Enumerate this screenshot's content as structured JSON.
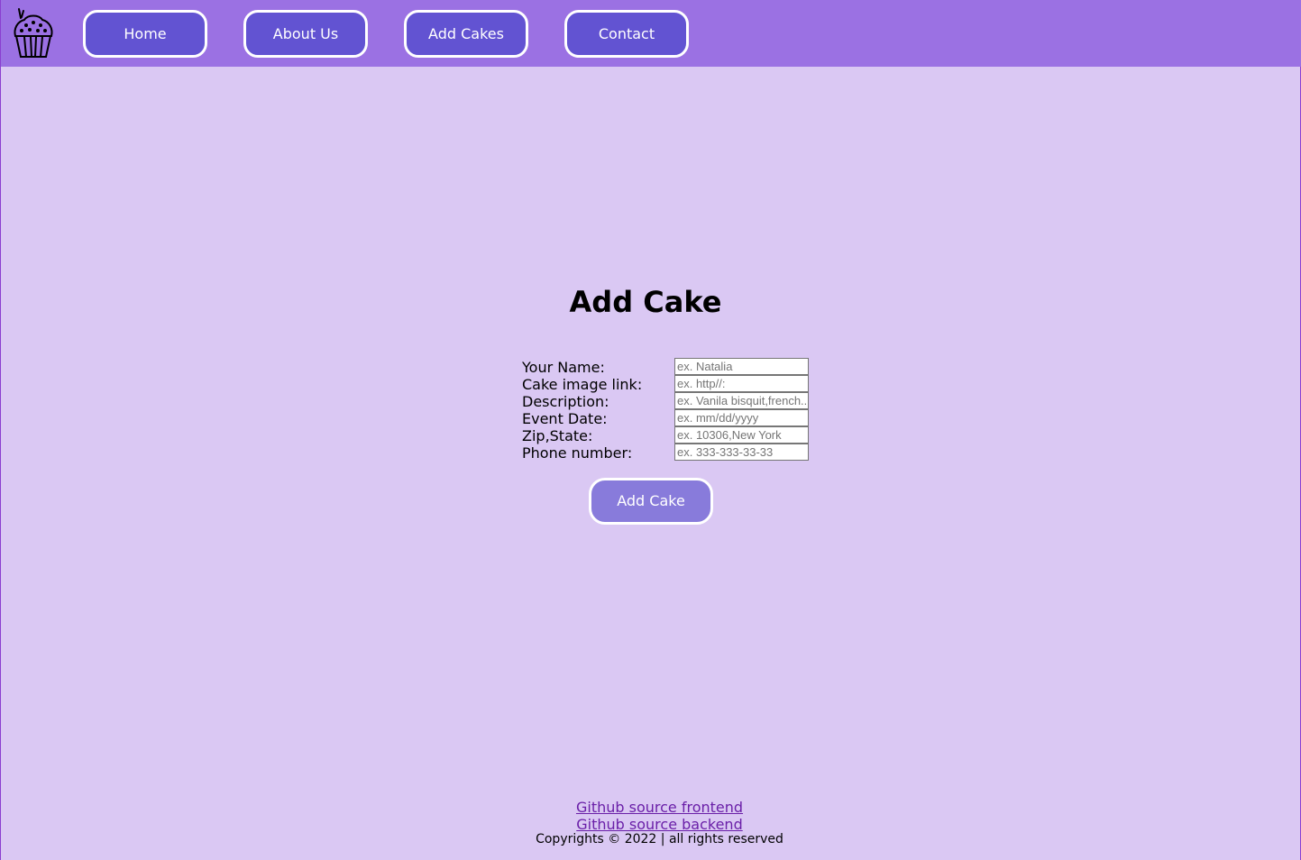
{
  "nav": {
    "logo_icon": "cupcake-icon",
    "items": [
      {
        "label": "Home"
      },
      {
        "label": "About Us"
      },
      {
        "label": "Add Cakes"
      },
      {
        "label": "Contact"
      }
    ]
  },
  "page": {
    "title": "Add Cake"
  },
  "form": {
    "fields": [
      {
        "label": "Your Name:",
        "placeholder": "ex. Natalia",
        "value": ""
      },
      {
        "label": "Cake image link:",
        "placeholder": "ex. http//:",
        "value": ""
      },
      {
        "label": "Description:",
        "placeholder": "ex. Vanila bisquit,french...",
        "value": ""
      },
      {
        "label": "Event Date:",
        "placeholder": "ex. mm/dd/yyyy",
        "value": ""
      },
      {
        "label": "Zip,State:",
        "placeholder": "ex. 10306,New York",
        "value": ""
      },
      {
        "label": "Phone number:",
        "placeholder": "ex. 333-333-33-33",
        "value": ""
      }
    ],
    "submit_label": "Add Cake"
  },
  "footer": {
    "frontend_link": "Github source frontend",
    "backend_link": "Github source backend",
    "copyright": "Copyrights © 2022 | all rights reserved"
  },
  "colors": {
    "page_background": "#dac8f3",
    "navbar_background": "#9b71e3",
    "nav_button": "#6253d2",
    "submit_button": "#887bdb",
    "link": "#6a1fa8"
  }
}
